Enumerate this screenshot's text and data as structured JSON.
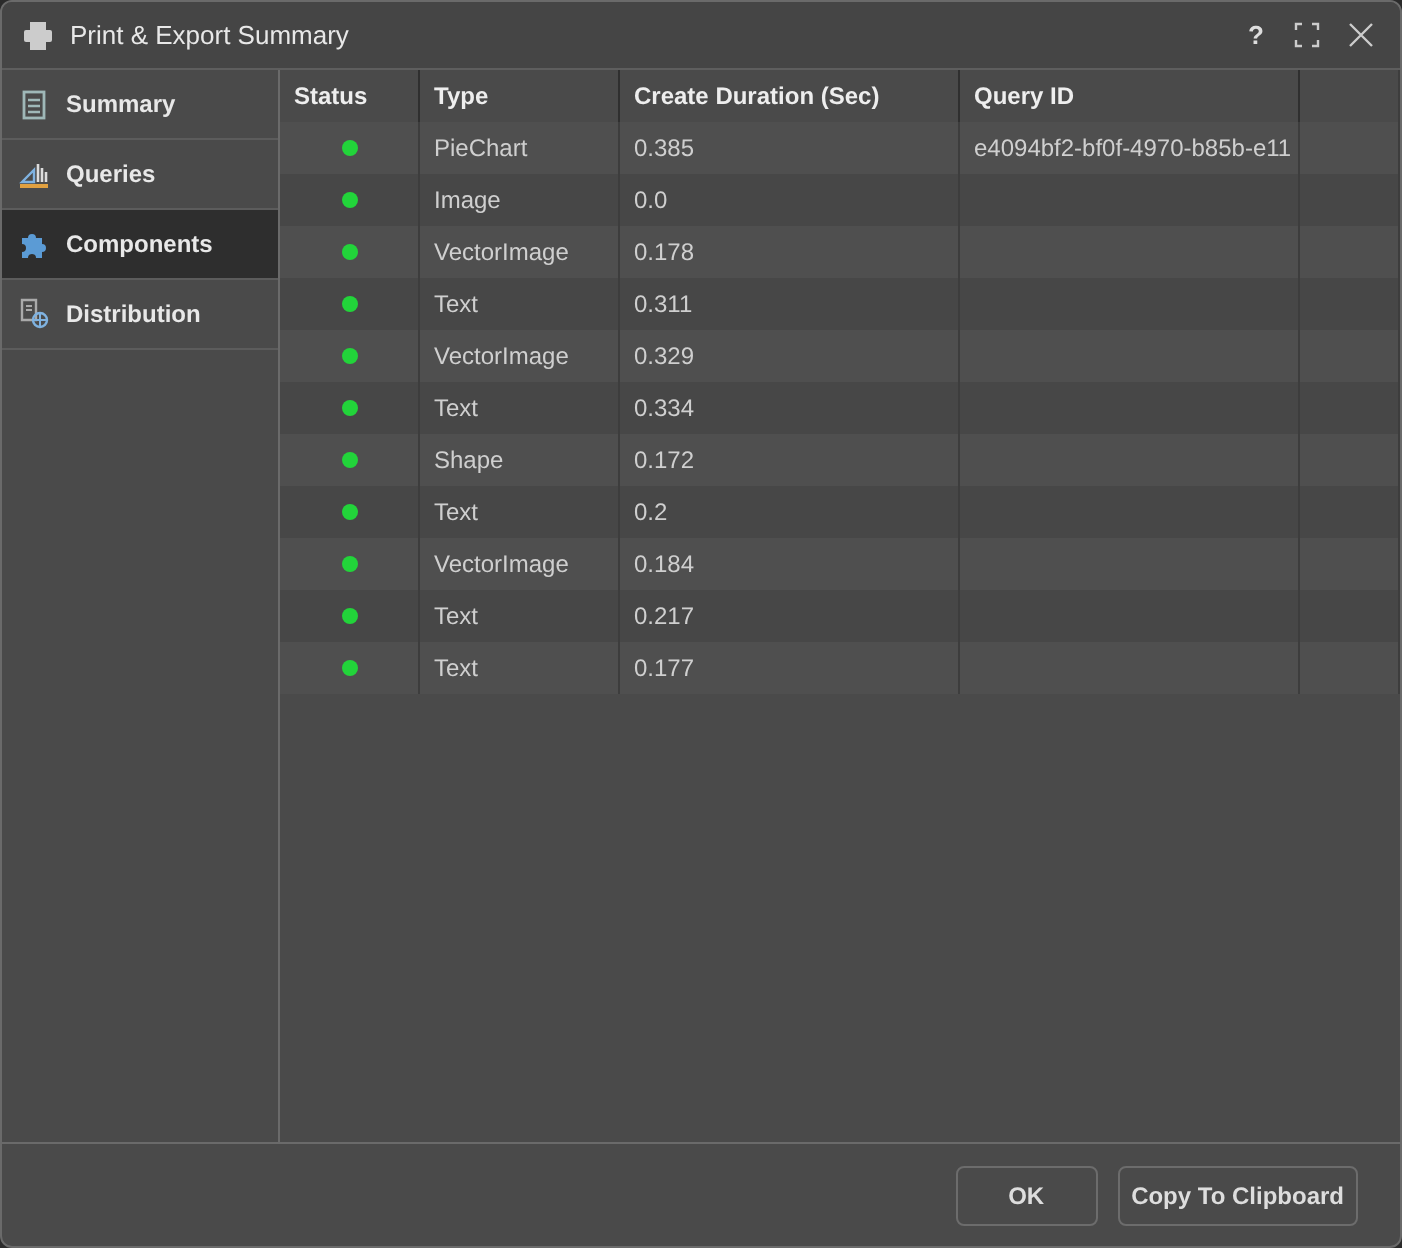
{
  "window": {
    "title": "Print & Export Summary",
    "controls": [
      "?"
    ]
  },
  "sidebar": {
    "items": [
      {
        "label": "Summary",
        "kind": "clipboard",
        "selected": false
      },
      {
        "label": "Queries",
        "kind": "chart",
        "selected": false
      },
      {
        "label": "Components",
        "kind": "puzzle",
        "selected": true
      },
      {
        "label": "Distribution",
        "kind": "document",
        "selected": false
      }
    ]
  },
  "table": {
    "columns": [
      "Status",
      "Type",
      "Create Duration (Sec)",
      "Query ID"
    ],
    "rows": [
      {
        "color": "#22d43a",
        "type": "PieChart",
        "duration": "0.385",
        "query_id": "e4094bf2-bf0f-4970-b85b-e11"
      },
      {
        "color": "#22d43a",
        "type": "Image",
        "duration": "0.0"
      },
      {
        "color": "#22d43a",
        "type": "VectorImage",
        "duration": "0.178"
      },
      {
        "color": "#22d43a",
        "type": "Text",
        "duration": "0.311"
      },
      {
        "color": "#22d43a",
        "type": "VectorImage",
        "duration": "0.329"
      },
      {
        "color": "#22d43a",
        "type": "Text",
        "duration": "0.334"
      },
      {
        "color": "#22d43a",
        "type": "Shape",
        "duration": "0.172"
      },
      {
        "color": "#22d43a",
        "type": "Text",
        "duration": "0.2"
      },
      {
        "color": "#22d43a",
        "type": "VectorImage",
        "duration": "0.184"
      },
      {
        "color": "#22d43a",
        "type": "Text",
        "duration": "0.217"
      },
      {
        "color": "#22d43a",
        "type": "Text",
        "duration": "0.177"
      }
    ]
  },
  "buttons": [
    "OK",
    "Copy To Clipboard"
  ]
}
